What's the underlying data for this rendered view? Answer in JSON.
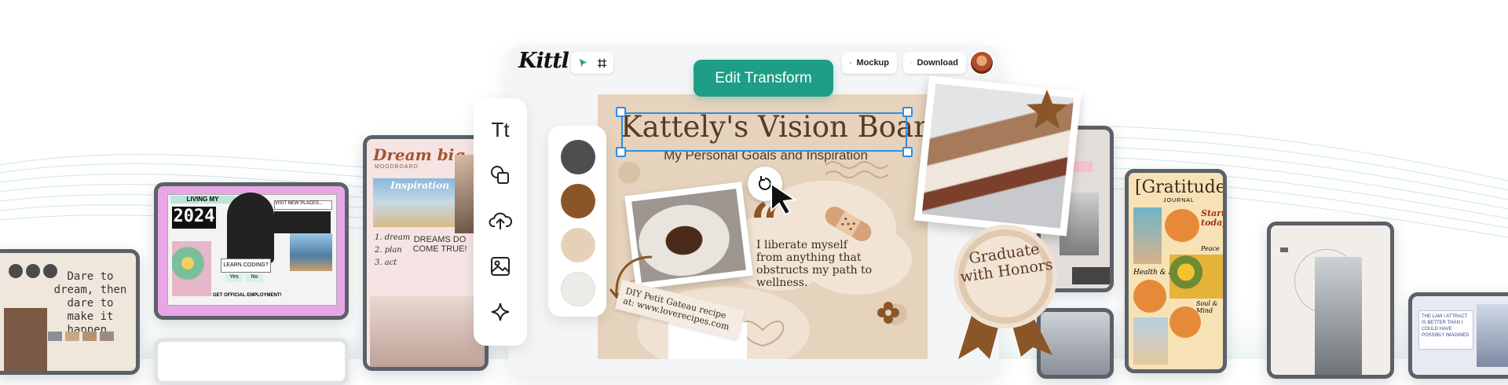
{
  "app": {
    "logo": "Kittl"
  },
  "toolbar": {
    "select_tool_icon": "pointer-icon",
    "frame_tool_icon": "frame-icon",
    "mockup_label": "Mockup",
    "download_label": "Download"
  },
  "edit_transform": "Edit Transform",
  "tools": [
    "text-tool-icon",
    "shapes-tool-icon",
    "upload-icon",
    "image-icon",
    "ai-sparkle-icon"
  ],
  "tools_glyph": {
    "text": "Tt"
  },
  "swatches": [
    "#4e4e4e",
    "#8a5628",
    "#e6d1b8",
    "#ecebe8"
  ],
  "board": {
    "title": "Kattely's Vision Board",
    "subtitle": "My Personal Goals and Inspiration",
    "quote": "I liberate myself from anything that obstructs my path to wellness.",
    "recipe": "DIY Petit Gateau recipe at: www.loverecipes.com",
    "medal": "Graduate with Honors",
    "quote_mark": "“"
  },
  "cards": {
    "dare": "Dare to dream, then dare to make it happen.",
    "living": {
      "header": "LIVING MY",
      "year": "2024",
      "visit": "VISIT NEW PLACES...",
      "coding": "LEARN CODING?",
      "yes": "Yes",
      "no": "No",
      "employment": "GET OFFICIAL EMPLOYMENT!"
    },
    "dream": {
      "title": "Dream big",
      "sub": "MOODBOARD",
      "banner": "Inspiration",
      "list": [
        "1. dream",
        "2. plan",
        "3. act"
      ],
      "come_true": "DREAMS DO COME TRUE!"
    },
    "gratitude": {
      "title": "[Gratitude]",
      "sub": "JOURNAL",
      "start": "Start today!",
      "health": "Health & Body",
      "peace": "Peace",
      "soul": "Soul & Mind"
    },
    "law": "THE LAW I ATTRACT IS BETTER THAN I COULD HAVE POSSIBLY IMAGINED"
  },
  "colors": {
    "accent": "#1e9e87",
    "selection": "#2d8ee6",
    "brown": "#8a5628"
  }
}
